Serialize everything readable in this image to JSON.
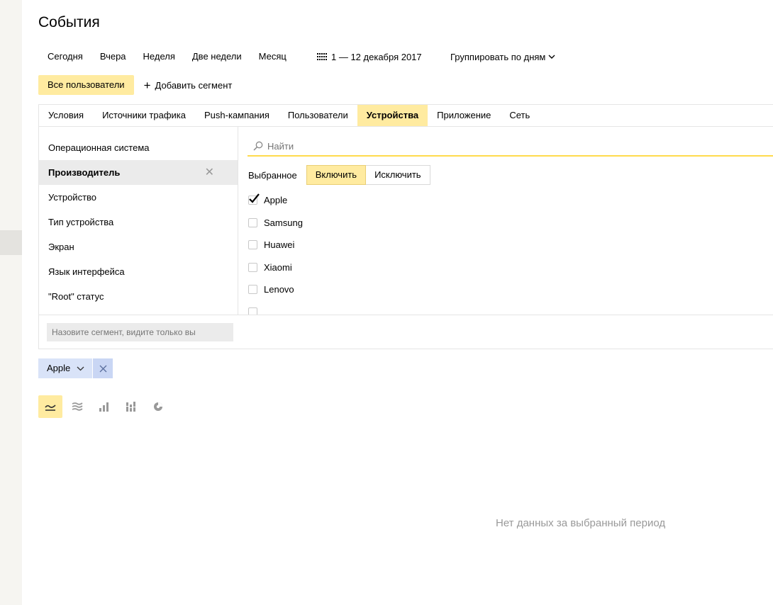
{
  "page": {
    "title": "События"
  },
  "periods": [
    "Сегодня",
    "Вчера",
    "Неделя",
    "Две недели",
    "Месяц"
  ],
  "date_range": {
    "label": "1 — 12 декабря 2017",
    "icon": "calendar-icon"
  },
  "group_by": {
    "label": "Группировать по дням",
    "icon": "chevron-down-icon"
  },
  "segments": {
    "all_users": "Все пользователи",
    "add_segment": "Добавить сегмент",
    "add_icon": "plus-icon"
  },
  "tabs": [
    {
      "label": "Условия",
      "active": false
    },
    {
      "label": "Источники трафика",
      "active": false
    },
    {
      "label": "Push-кампания",
      "active": false
    },
    {
      "label": "Пользователи",
      "active": false
    },
    {
      "label": "Устройства",
      "active": true
    },
    {
      "label": "Приложение",
      "active": false
    },
    {
      "label": "Сеть",
      "active": false
    }
  ],
  "attributes": [
    {
      "label": "Операционная система",
      "active": false
    },
    {
      "label": "Производитель",
      "active": true
    },
    {
      "label": "Устройство",
      "active": false
    },
    {
      "label": "Тип устройства",
      "active": false
    },
    {
      "label": "Экран",
      "active": false
    },
    {
      "label": "Язык интерфейса",
      "active": false
    },
    {
      "label": "\"Root\" статус",
      "active": false
    }
  ],
  "search": {
    "placeholder": "Найти",
    "icon": "search-icon"
  },
  "filter": {
    "label": "Выбранное",
    "include": "Включить",
    "exclude": "Исключить",
    "selected_mode": "include"
  },
  "values": [
    {
      "label": "Apple",
      "checked": true
    },
    {
      "label": "Samsung",
      "checked": false
    },
    {
      "label": "Huawei",
      "checked": false
    },
    {
      "label": "Xiaomi",
      "checked": false
    },
    {
      "label": "Lenovo",
      "checked": false
    }
  ],
  "segment_name": {
    "placeholder": "Назовите сегмент, видите только вы"
  },
  "chip": {
    "label": "Apple"
  },
  "chart_types": [
    {
      "icon": "line-chart-icon",
      "active": true
    },
    {
      "icon": "stacked-area-icon",
      "active": false
    },
    {
      "icon": "bar-chart-icon",
      "active": false
    },
    {
      "icon": "stacked-bar-icon",
      "active": false
    },
    {
      "icon": "pie-chart-icon",
      "active": false
    }
  ],
  "empty_message": "Нет данных за выбранный период",
  "colors": {
    "accent": "#ffeba0",
    "search_underline": "#ffdb4d",
    "chip": "#d9e3f8",
    "muted_text": "#999999"
  }
}
